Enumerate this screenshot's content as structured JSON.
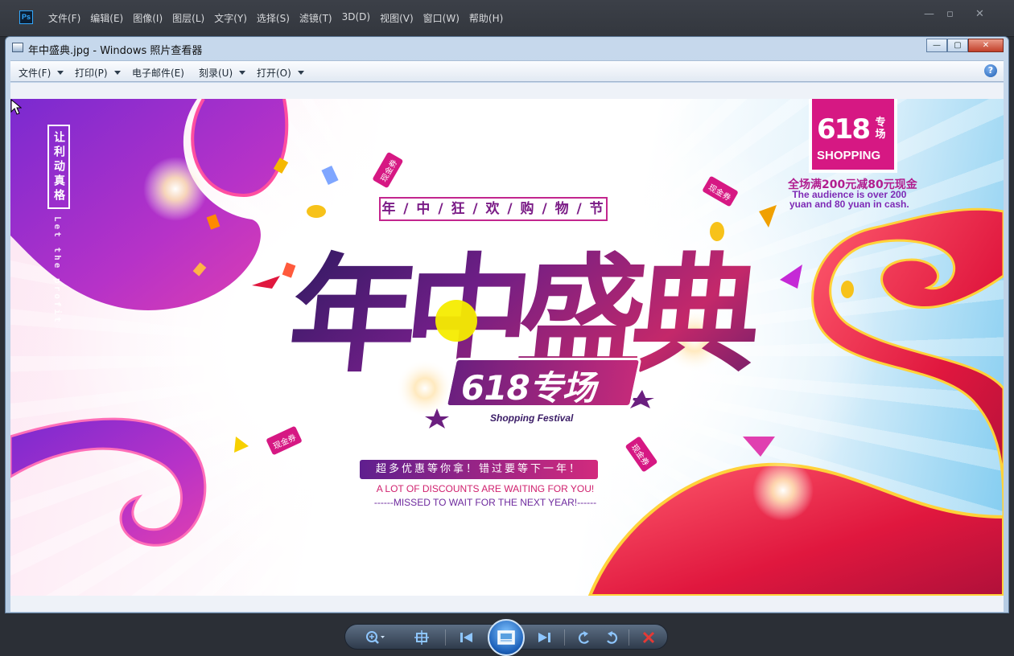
{
  "photoshop": {
    "logo": "Ps",
    "menu": [
      "文件(F)",
      "编辑(E)",
      "图像(I)",
      "图层(L)",
      "文字(Y)",
      "选择(S)",
      "滤镜(T)",
      "3D(D)",
      "视图(V)",
      "窗口(W)",
      "帮助(H)"
    ]
  },
  "viewer": {
    "title": "年中盛典.jpg - Windows 照片查看器",
    "toolbar": [
      {
        "label": "文件(F)",
        "has_menu": true
      },
      {
        "label": "打印(P)",
        "has_menu": true
      },
      {
        "label": "电子邮件(E)",
        "has_menu": false
      },
      {
        "label": "刻录(U)",
        "has_menu": true
      },
      {
        "label": "打开(O)",
        "has_menu": true
      }
    ],
    "help_label": "?"
  },
  "poster": {
    "vertical_tag": "让利动真格",
    "vertical_en": "Let the profit",
    "badge_number": "618",
    "badge_zhuanchang": "专场",
    "badge_en": "SHOPPING",
    "promo_cn": "全场满200元减80元现金",
    "promo_en_line1": "The audience is over 200",
    "promo_en_line2": "yuan and 80 yuan in cash.",
    "festival": "年 / 中 / 狂 / 欢 / 购 / 物 / 节",
    "main_title": "年中盛典",
    "sub_title": "618专场",
    "sub_en": "Shopping Festival",
    "slogan_cn": "超多优惠等你拿！错过要等下一年！",
    "slogan_en1": "A LOT OF DISCOUNTS ARE WAITING FOR YOU!",
    "slogan_en2": "------MISSED TO WAIT FOR THE NEXT YEAR!------",
    "coupon_label": "现金券"
  },
  "colors": {
    "accent_pink": "#d61883",
    "accent_purple": "#6e1e86",
    "ribbon_red": "#e0173e",
    "sky_blue": "#7fcbf0"
  },
  "nav": {
    "buttons": [
      "zoom-icon",
      "actual-size-icon",
      "previous-icon",
      "slideshow-icon",
      "next-icon",
      "rotate-left-icon",
      "rotate-right-icon",
      "delete-icon"
    ]
  }
}
